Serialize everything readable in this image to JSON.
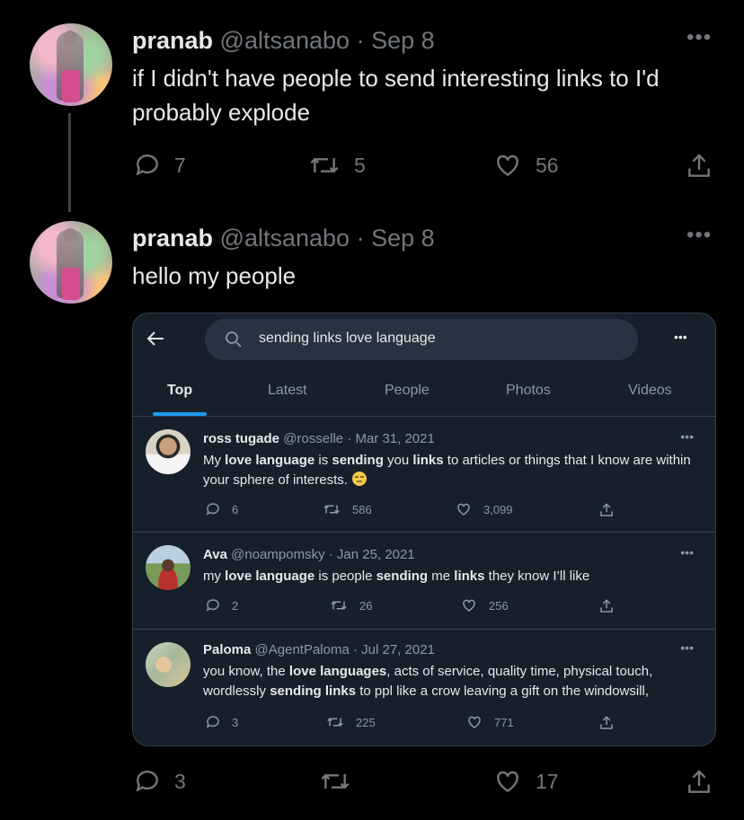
{
  "tweet1": {
    "name": "pranab",
    "handle": "@altsanabo",
    "date": "Sep 8",
    "text": "if I didn't have people to send interesting links to I'd probably explode",
    "replies": "7",
    "retweets": "5",
    "likes": "56"
  },
  "tweet2": {
    "name": "pranab",
    "handle": "@altsanabo",
    "date": "Sep 8",
    "text": "hello my people",
    "replies": "3",
    "retweets": "",
    "likes": "17"
  },
  "embed": {
    "search_query": "sending links love language",
    "tabs": [
      "Top",
      "Latest",
      "People",
      "Photos",
      "Videos"
    ],
    "results": [
      {
        "name": "ross tugade",
        "handle_date": "@rosselle · Mar 31, 2021",
        "replies": "6",
        "retweets": "586",
        "likes": "3,099"
      },
      {
        "name": "Ava",
        "handle_date": "@noampomsky · Jan 25, 2021",
        "replies": "2",
        "retweets": "26",
        "likes": "256"
      },
      {
        "name": "Paloma",
        "handle_date": "@AgentPaloma · Jul 27, 2021",
        "replies": "3",
        "retweets": "225",
        "likes": "771"
      }
    ]
  },
  "colors": {
    "background": "#000000",
    "embed_background": "#15202b",
    "accent": "#1d9bf0",
    "muted": "#71767b"
  },
  "icons": [
    "more-icon",
    "reply-icon",
    "retweet-icon",
    "like-icon",
    "share-icon",
    "back-arrow-icon",
    "search-icon",
    "emoji-face-icon"
  ]
}
